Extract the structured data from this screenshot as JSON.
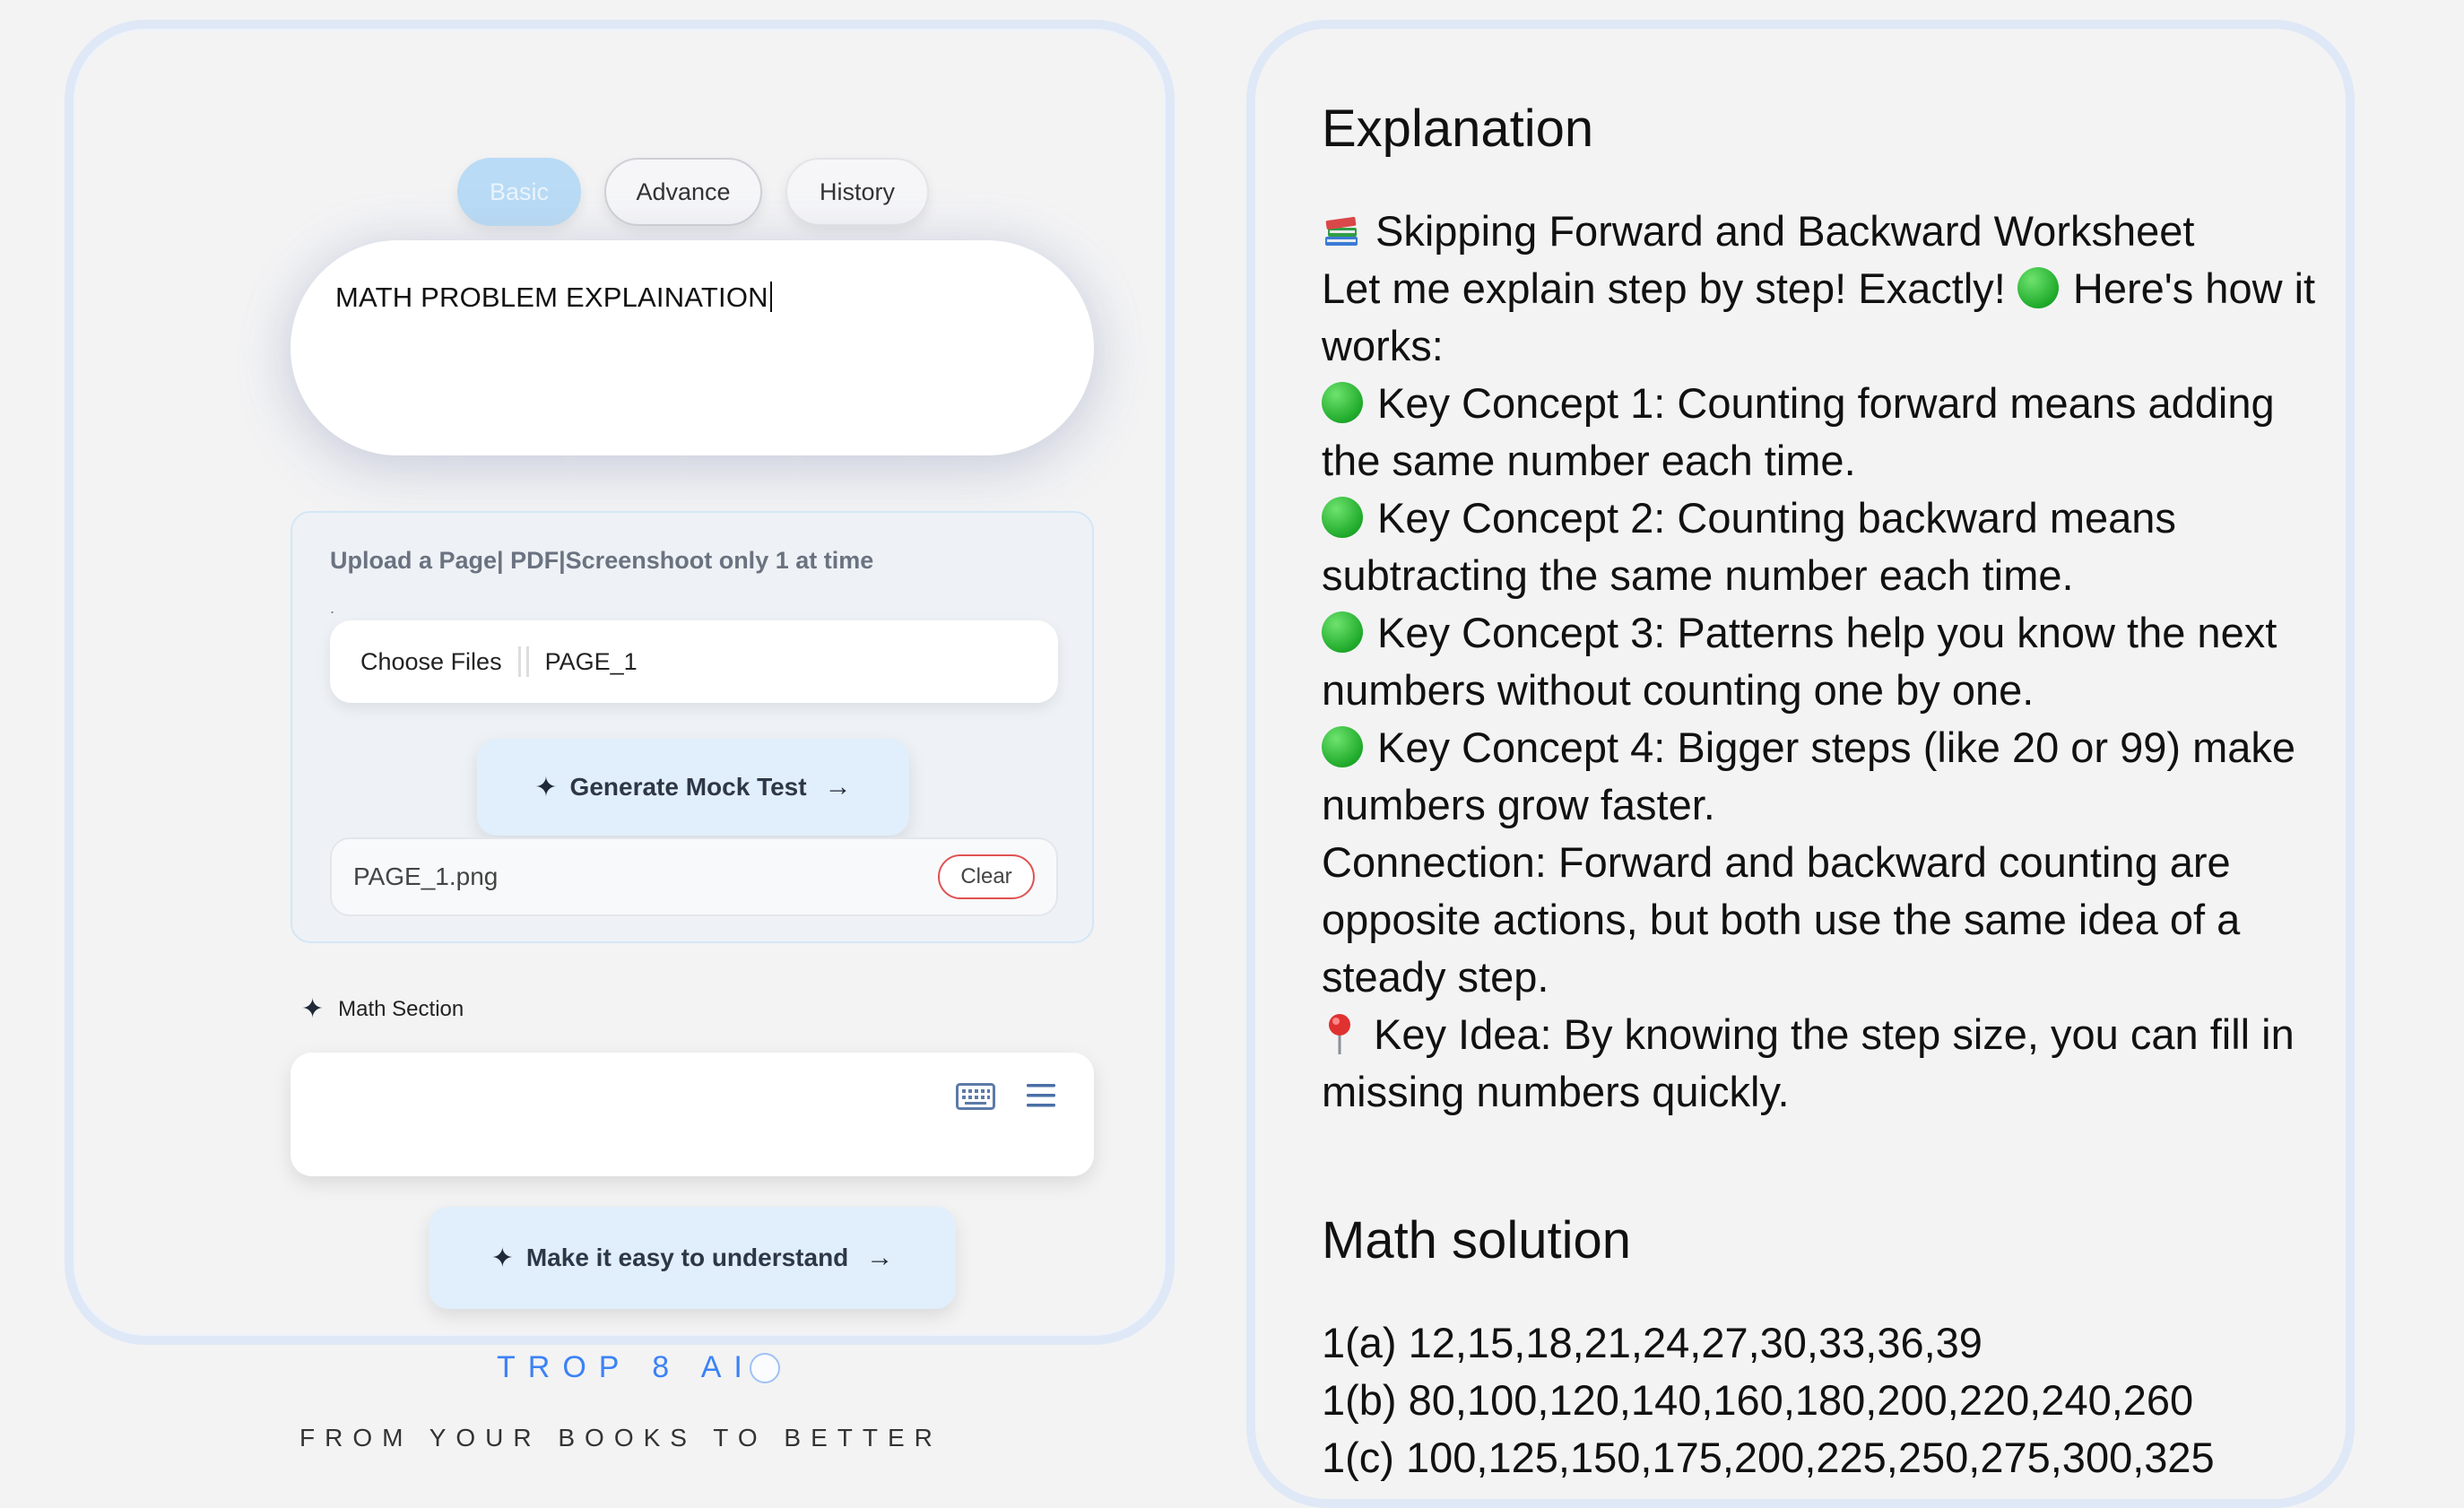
{
  "tabs": [
    {
      "label": "Basic",
      "active": true
    },
    {
      "label": "Advance",
      "active": false
    },
    {
      "label": "History",
      "active": false
    }
  ],
  "prompt": {
    "value": "MATH PROBLEM EXPLAINATION"
  },
  "upload": {
    "label": "Upload a Page| PDF|Screenshoot only 1 at time",
    "dot": ".",
    "choose_label": "Choose Files",
    "chosen_file": "PAGE_1",
    "generate_label": "Generate Mock Test",
    "file_row_name": "PAGE_1.png",
    "clear_label": "Clear"
  },
  "math_section": {
    "label": "Math Section",
    "keyboard_icon": "keyboard-icon",
    "menu_icon": "menu-icon"
  },
  "easy_button": {
    "label": "Make it easy to understand"
  },
  "brand": {
    "name": "TROP 8 AI",
    "tagline": "FROM YOUR BOOKS TO BETTER"
  },
  "explanation": {
    "title": "Explanation",
    "lines": [
      {
        "icon": "books-icon",
        "text": "Skipping Forward and Backward Worksheet"
      },
      {
        "icon": "",
        "text": "Let me explain step by step! Exactly!"
      },
      {
        "icon": "green-circle-icon",
        "text": "Here's how it works:"
      },
      {
        "icon": "green-circle-icon",
        "text": "Key Concept 1: Counting forward means adding the same number each time."
      },
      {
        "icon": "green-circle-icon",
        "text": "Key Concept 2: Counting backward means subtracting the same number each time."
      },
      {
        "icon": "green-circle-icon",
        "text": "Key Concept 3: Patterns help you know the next numbers without counting one by one."
      },
      {
        "icon": "green-circle-icon",
        "text": "Key Concept 4: Bigger steps (like 20 or 99) make numbers grow faster."
      },
      {
        "icon": "",
        "text": "Connection: Forward and backward counting are opposite actions, but both use the same idea of a steady step."
      },
      {
        "icon": "pin-icon",
        "text": "Key Idea: By knowing the step size, you can fill in missing numbers quickly."
      }
    ]
  },
  "solution": {
    "title": "Math solution",
    "lines": [
      "1(a) 12,15,18,21,24,27,30,33,36,39",
      "1(b) 80,100,120,140,160,180,200,220,240,260",
      "1(c) 100,125,150,175,200,225,250,275,300,325"
    ]
  },
  "colors": {
    "accent": "#3b82f6",
    "active_tab": "#b9dbf5",
    "button_bg": "#e1eefb",
    "clear_border": "#e05252",
    "panel_border": "#dfe8f6"
  }
}
